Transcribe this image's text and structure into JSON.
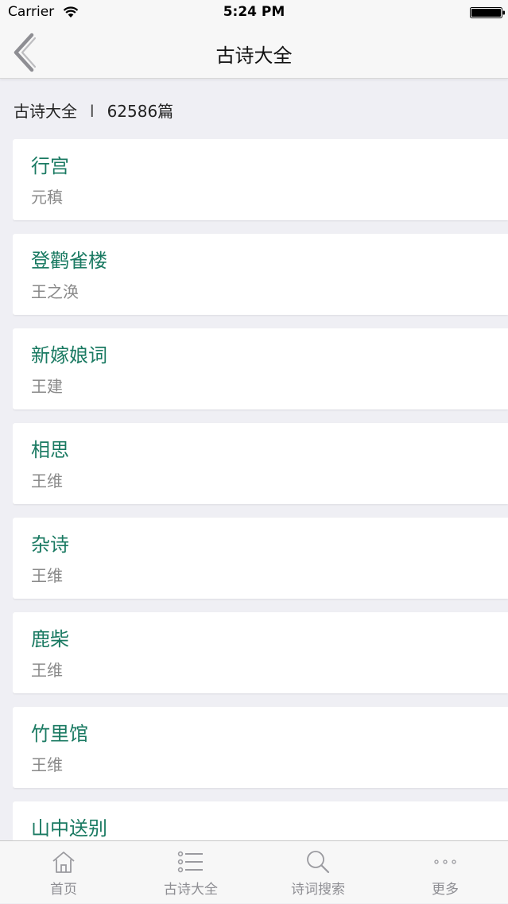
{
  "status_bar": {
    "carrier": "Carrier",
    "time": "5:24 PM"
  },
  "nav": {
    "title": "古诗大全"
  },
  "summary": {
    "category": "古诗大全",
    "separator": "l",
    "count": "62586篇"
  },
  "poems": [
    {
      "title": "行宫",
      "author": "元稹"
    },
    {
      "title": "登鹳雀楼",
      "author": "王之涣"
    },
    {
      "title": "新嫁娘词",
      "author": "王建"
    },
    {
      "title": "相思",
      "author": "王维"
    },
    {
      "title": "杂诗",
      "author": "王维"
    },
    {
      "title": "鹿柴",
      "author": "王维"
    },
    {
      "title": "竹里馆",
      "author": "王维"
    },
    {
      "title": "山中送别",
      "author": ""
    }
  ],
  "tabs": [
    {
      "label": "首页",
      "icon": "home-icon"
    },
    {
      "label": "古诗大全",
      "icon": "list-icon"
    },
    {
      "label": "诗词搜索",
      "icon": "search-icon"
    },
    {
      "label": "更多",
      "icon": "more-icon"
    }
  ],
  "colors": {
    "accent": "#1a7a62",
    "author": "#8a8a8a",
    "tab_inactive": "#8e8e93",
    "background": "#efeff4"
  }
}
